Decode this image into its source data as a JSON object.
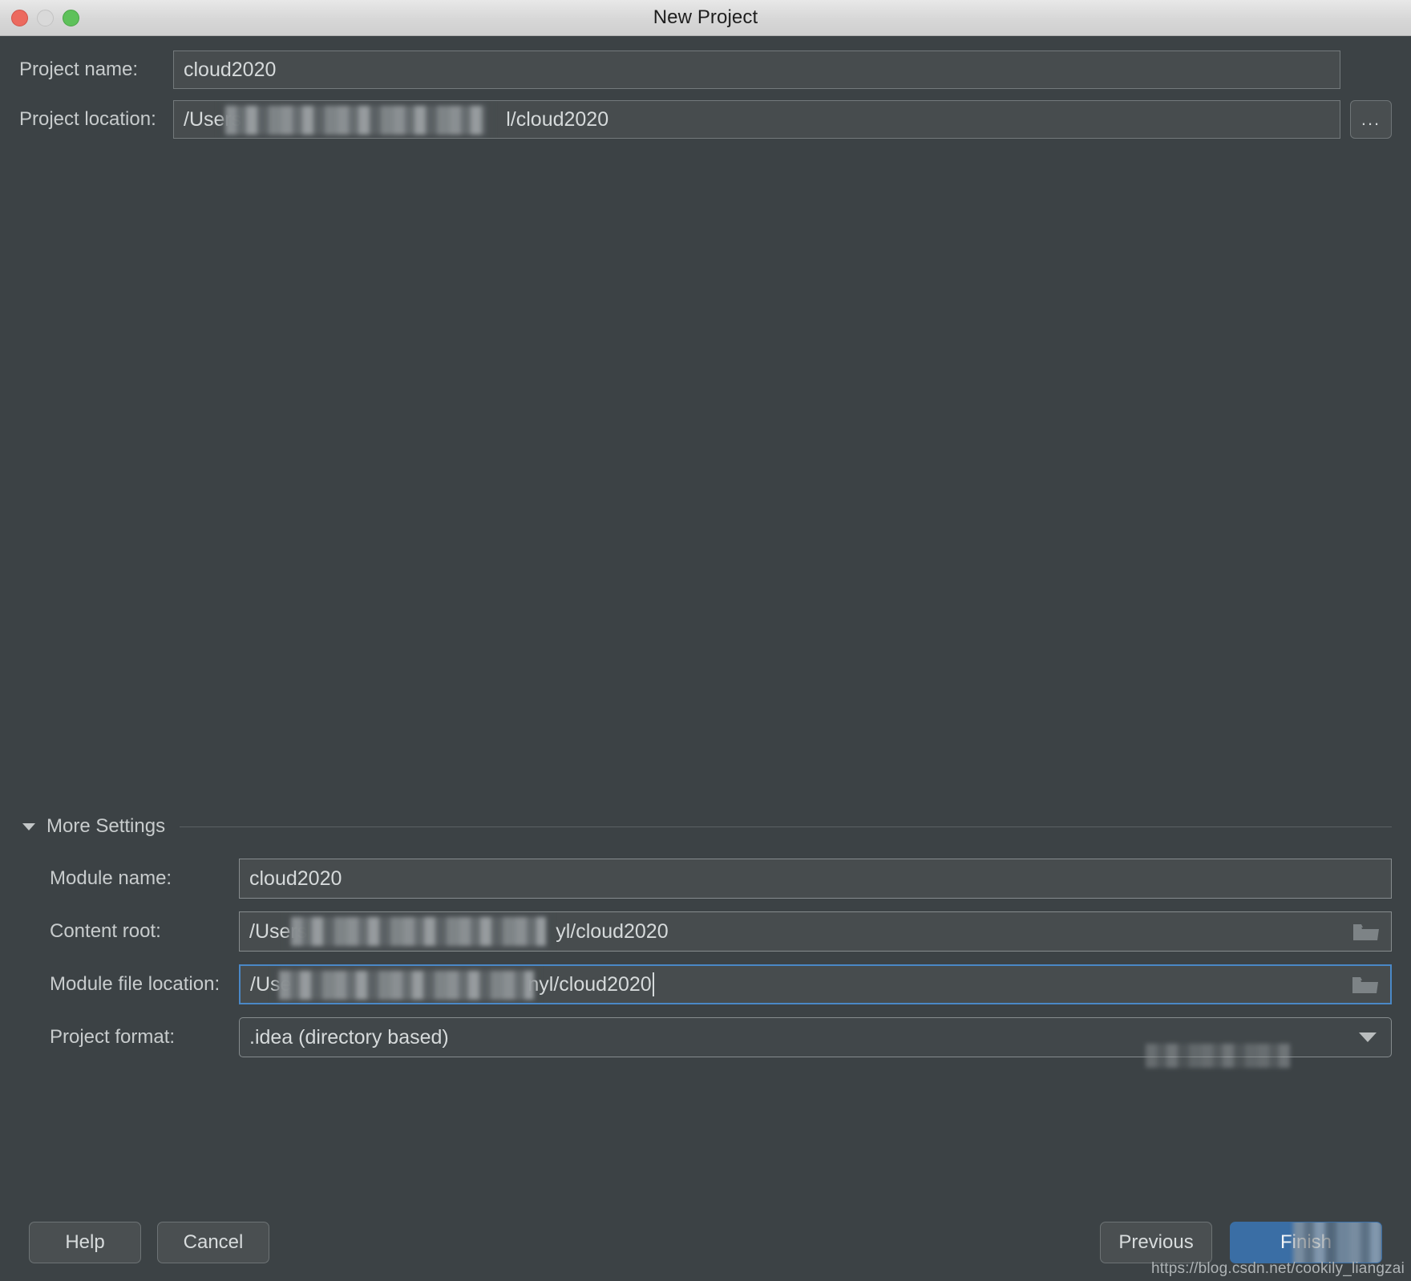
{
  "window": {
    "title": "New Project",
    "traffic_lights": [
      "close-button",
      "minimize-button",
      "maximize-button"
    ],
    "bg_color": "#3c4245",
    "accent_color": "#3a6ea5",
    "focus_border_color": "#4a88c7"
  },
  "top_form": {
    "project_name": {
      "label": "Project name:",
      "value": "cloud2020"
    },
    "project_location": {
      "label": "Project location:",
      "value_prefix": "/Users",
      "value_suffix": "l/cloud2020",
      "redacted": true,
      "browse_label": "..."
    }
  },
  "more_settings": {
    "label": "More Settings",
    "expanded": true,
    "toggle_icon": "chevron-down-icon",
    "rows": [
      {
        "label": "Module name:",
        "type": "text",
        "value": "cloud2020",
        "redacted": false,
        "focused": false,
        "icon": null
      },
      {
        "label": "Content root:",
        "type": "path",
        "value_prefix": "/Users",
        "value_suffix": "yl/cloud2020",
        "redacted": true,
        "focused": false,
        "icon": "folder-icon"
      },
      {
        "label": "Module file location:",
        "type": "path",
        "value_prefix": "/Use",
        "value_suffix": "nyl/cloud2020",
        "redacted": true,
        "focused": true,
        "caret": true,
        "icon": "folder-icon"
      },
      {
        "label": "Project format:",
        "type": "combo",
        "value": ".idea (directory based)",
        "redacted": false,
        "focused": false,
        "icon": "chevron-down-icon"
      }
    ]
  },
  "footer": {
    "help_label": "Help",
    "cancel_label": "Cancel",
    "previous_label": "Previous",
    "finish_label": "Finish",
    "finish_partially_obscured": true
  },
  "watermark": {
    "text": "https://blog.csdn.net/cookily_liangzai"
  }
}
